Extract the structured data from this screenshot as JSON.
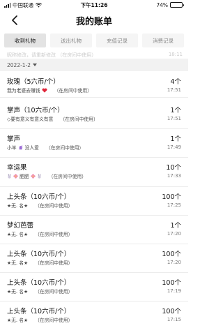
{
  "status_bar": {
    "carrier": "中国联通",
    "time": "下午11:26",
    "battery": "74%",
    "battery_level": 0.74
  },
  "nav": {
    "title": "我的账单"
  },
  "tabs": [
    {
      "label": "收到礼物",
      "active": true
    },
    {
      "label": "送出礼物",
      "active": false
    },
    {
      "label": "充值记录",
      "active": false
    },
    {
      "label": "消费记录",
      "active": false
    }
  ],
  "faded_row": {
    "text": "昵称修改，请重新修改   （在房间中使用）",
    "time": "18:11"
  },
  "date_filter": "2022-1-2",
  "records": [
    {
      "name": "玫瑰（5六币/个）",
      "note": "我为老婆去赚钱",
      "note_icon": "heart-icon",
      "room": "（在房间中使用）",
      "count": "4个",
      "time": "17:51"
    },
    {
      "name": "掌声（10六币/个）",
      "note": "◇要有意义有意义有意",
      "note_icon": "",
      "room": "（在房间中使用）",
      "count": "1个",
      "time": "17:51"
    },
    {
      "name": "掌声",
      "note": "小羊",
      "note_icon": "unicorn-icon",
      "note_suffix": "没人爱",
      "room": "（在房间中使用）",
      "count": "1个",
      "time": "17:49"
    },
    {
      "name": "幸运果",
      "note": "肥肥",
      "note_icon": "rabbit-flower-icon",
      "room": "（在房间中使用）",
      "count": "10个",
      "time": "17:33"
    },
    {
      "name": "上头条（10六币/个）",
      "note": "★无. 名★",
      "note_icon": "",
      "room": "（在房间中使用）",
      "count": "100个",
      "time": "17:25"
    },
    {
      "name": "梦幻芭蕾",
      "note": "★无. 名★",
      "note_icon": "",
      "room": "（在房间中使用）",
      "count": "1个",
      "time": "17:20"
    },
    {
      "name": "上头条（10六币/个）",
      "note": "★无. 名★",
      "note_icon": "",
      "room": "（在房间中使用）",
      "count": "100个",
      "time": "17:20"
    },
    {
      "name": "上头条（10六币/个）",
      "note": "★无. 名★",
      "note_icon": "",
      "room": "（在房间中使用）",
      "count": "100个",
      "time": "17:19"
    },
    {
      "name": "上头条（10六币/个）",
      "note": "★无. 名★",
      "note_icon": "",
      "room": "（在房间中使用）",
      "count": "100个",
      "time": "17:15"
    }
  ]
}
